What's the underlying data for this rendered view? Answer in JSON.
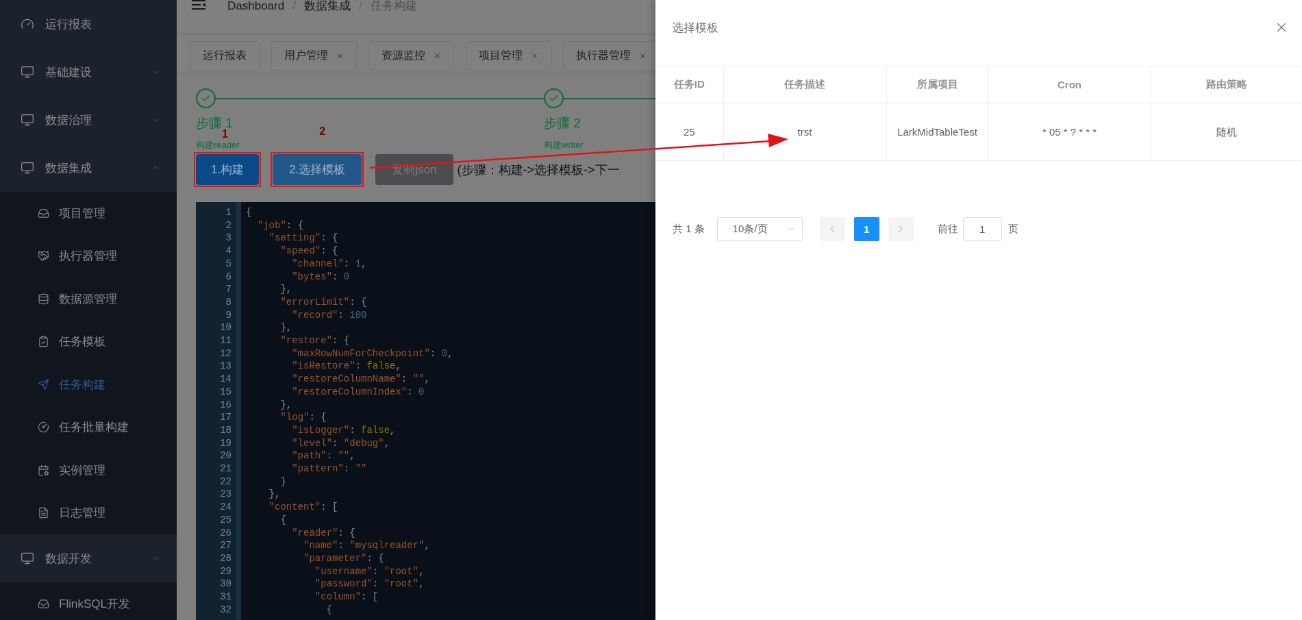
{
  "sidebar": {
    "items": [
      {
        "kind": "link",
        "label": "运行报表",
        "selected": false
      },
      {
        "kind": "group",
        "label": "基础建设",
        "expanded": false
      },
      {
        "kind": "group",
        "label": "数据治理",
        "expanded": false
      },
      {
        "kind": "group",
        "label": "数据集成",
        "expanded": true,
        "children": [
          {
            "label": "项目管理",
            "selected": false
          },
          {
            "label": "执行器管理",
            "selected": false
          },
          {
            "label": "数据源管理",
            "selected": false
          },
          {
            "label": "任务模板",
            "selected": false
          },
          {
            "label": "任务构建",
            "selected": true
          },
          {
            "label": "任务批量构建",
            "selected": false
          },
          {
            "label": "实例管理",
            "selected": false
          },
          {
            "label": "日志管理",
            "selected": false
          }
        ]
      },
      {
        "kind": "group",
        "label": "数据开发",
        "expanded": true,
        "children": [
          {
            "label": "FlinkSQL开发",
            "selected": false
          }
        ]
      }
    ]
  },
  "breadcrumb": {
    "items": [
      "Dashboard",
      "数据集成",
      "任务构建"
    ],
    "separator": "/"
  },
  "tabs": [
    {
      "label": "运行报表",
      "closable": false,
      "selected": false
    },
    {
      "label": "用户管理",
      "closable": true,
      "selected": false
    },
    {
      "label": "资源监控",
      "closable": true,
      "selected": false
    },
    {
      "label": "项目管理",
      "closable": true,
      "selected": false
    },
    {
      "label": "执行器管理",
      "closable": true,
      "selected": false
    }
  ],
  "steps": [
    {
      "title": "步骤 1",
      "description": "构建reader",
      "finished": true
    },
    {
      "title": "步骤 2",
      "description": "构建writer",
      "finished": true
    }
  ],
  "buttons": [
    {
      "label": "1.构建",
      "kind": "focused"
    },
    {
      "label": "2.选择模板",
      "kind": "primary"
    },
    {
      "label": "复制json",
      "kind": "muted"
    }
  ],
  "hint": "(步骤：构建->选择模板->下一",
  "annotations": [
    {
      "label": "1"
    },
    {
      "label": "2"
    }
  ],
  "editor": {
    "lines": [
      {
        "n": "1",
        "code": "{"
      },
      {
        "n": "2",
        "code": "  \"job\": {"
      },
      {
        "n": "3",
        "code": "    \"setting\": {"
      },
      {
        "n": "4",
        "code": "      \"speed\": {"
      },
      {
        "n": "5",
        "code": "        \"channel\": 1,"
      },
      {
        "n": "6",
        "code": "        \"bytes\": 0"
      },
      {
        "n": "7",
        "code": "      },"
      },
      {
        "n": "8",
        "code": "      \"errorLimit\": {"
      },
      {
        "n": "9",
        "code": "        \"record\": 100"
      },
      {
        "n": "10",
        "code": "      },"
      },
      {
        "n": "11",
        "code": "      \"restore\": {"
      },
      {
        "n": "12",
        "code": "        \"maxRowNumForCheckpoint\": 0,"
      },
      {
        "n": "13",
        "code": "        \"isRestore\": false,"
      },
      {
        "n": "14",
        "code": "        \"restoreColumnName\": \"\","
      },
      {
        "n": "15",
        "code": "        \"restoreColumnIndex\": 0"
      },
      {
        "n": "16",
        "code": "      },"
      },
      {
        "n": "17",
        "code": "      \"log\": {"
      },
      {
        "n": "18",
        "code": "        \"isLogger\": false,"
      },
      {
        "n": "19",
        "code": "        \"level\": \"debug\","
      },
      {
        "n": "20",
        "code": "        \"path\": \"\","
      },
      {
        "n": "21",
        "code": "        \"pattern\": \"\""
      },
      {
        "n": "22",
        "code": "      }"
      },
      {
        "n": "23",
        "code": "    },"
      },
      {
        "n": "24",
        "code": "    \"content\": ["
      },
      {
        "n": "25",
        "code": "      {"
      },
      {
        "n": "26",
        "code": "        \"reader\": {"
      },
      {
        "n": "27",
        "code": "          \"name\": \"mysqlreader\","
      },
      {
        "n": "28",
        "code": "          \"parameter\": {"
      },
      {
        "n": "29",
        "code": "            \"username\": \"root\","
      },
      {
        "n": "30",
        "code": "            \"password\": \"root\","
      },
      {
        "n": "31",
        "code": "            \"column\": ["
      },
      {
        "n": "32",
        "code": "              {"
      }
    ]
  },
  "drawer": {
    "title": "选择模板",
    "table": {
      "columns": [
        "任务ID",
        "任务描述",
        "所属项目",
        "Cron",
        "路由策略"
      ],
      "rows": [
        [
          "25",
          "trst",
          "LarkMidTableTest",
          "* 05 * ? * * *",
          "随机"
        ]
      ]
    },
    "pagination": {
      "total": "共 1 条",
      "page_size": "10条/页",
      "pages": [
        {
          "label": "1",
          "selected": true
        }
      ],
      "goto_label": "前往",
      "goto_value": "1",
      "goto_suffix": "页"
    }
  }
}
